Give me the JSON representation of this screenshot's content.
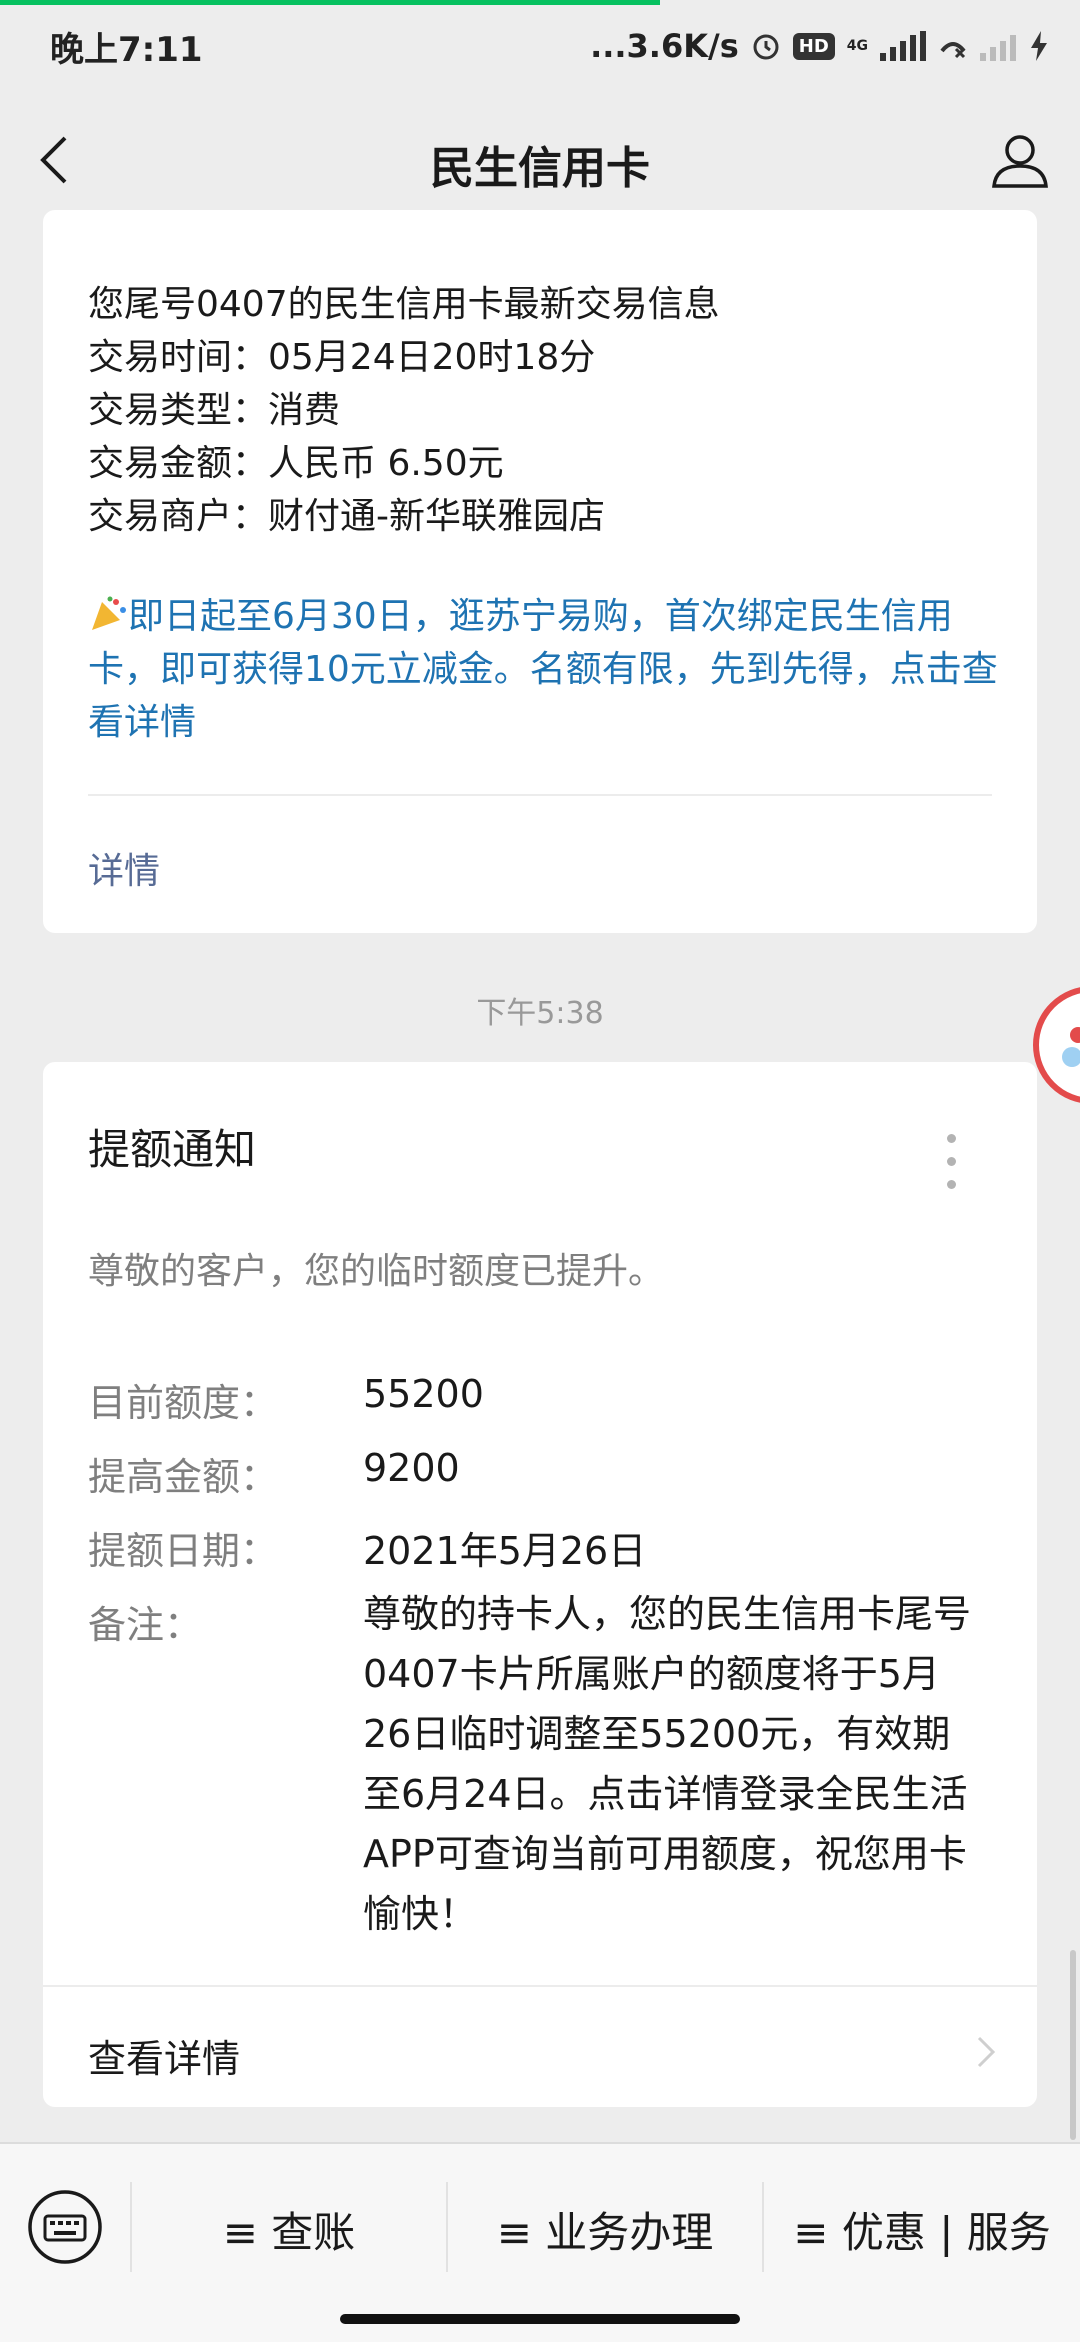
{
  "status_bar": {
    "time": "晚上7:11",
    "net_speed": "...3.6K/s",
    "hd": "HD",
    "network": "4G"
  },
  "nav": {
    "title": "民生信用卡"
  },
  "transaction_card": {
    "lines": "您尾号0407的民生信用卡最新交易信息\n交易时间：05月24日20时18分\n交易类型：消费\n交易金额：人民币 6.50元\n交易商户：财付通-新华联雅园店",
    "promo": "即日起至6月30日，逛苏宁易购，首次绑定民生信用卡，即可获得10元立减金。名额有限，先到先得，点击查看详情",
    "detail_link": "详情"
  },
  "timestamp": "下午5:38",
  "limit_card": {
    "title": "提额通知",
    "subtitle": "尊敬的客户，您的临时额度已提升。",
    "rows": [
      {
        "label": "目前额度：",
        "value": "55200"
      },
      {
        "label": "提高金额：",
        "value": "9200"
      },
      {
        "label": "提额日期：",
        "value": "2021年5月26日"
      }
    ],
    "note_label": "备注：",
    "note_value": "尊敬的持卡人，您的民生信用卡尾号0407卡片所属账户的额度将于5月26日临时调整至55200元，有效期至6月24日。点击详情登录全民生活APP可查询当前可用额度，祝您用卡愉快！",
    "view_details": "查看详情"
  },
  "bottom_menu": {
    "items": [
      "≡ 查账",
      "≡ 业务办理",
      "≡ 优惠 | 服务"
    ]
  },
  "icons": {
    "back": "back-arrow-icon",
    "profile": "user-profile-icon",
    "keyboard": "keyboard-icon",
    "more": "more-vertical-icon",
    "chevron": "chevron-right-icon",
    "promo_emoji": "party-emoji-icon"
  },
  "colors": {
    "promo_text": "#1e73b2",
    "link": "#576b95",
    "background": "#ededed"
  }
}
